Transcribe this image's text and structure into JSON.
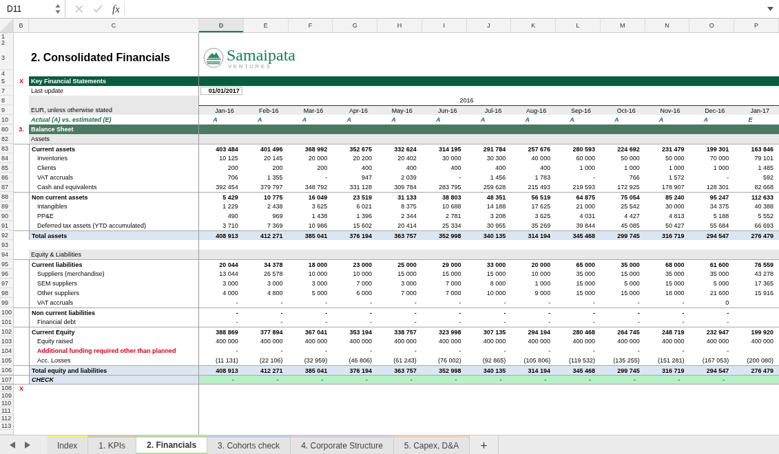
{
  "formula_bar": {
    "cell_ref": "D11",
    "fx": "fx"
  },
  "columns": [
    {
      "letter": "B",
      "selected": false
    },
    {
      "letter": "C",
      "selected": false
    },
    {
      "letter": "D",
      "selected": true
    },
    {
      "letter": "E",
      "selected": false
    },
    {
      "letter": "F",
      "selected": false
    },
    {
      "letter": "G",
      "selected": false
    },
    {
      "letter": "H",
      "selected": false
    },
    {
      "letter": "I",
      "selected": false
    },
    {
      "letter": "J",
      "selected": false
    },
    {
      "letter": "K",
      "selected": false
    },
    {
      "letter": "L",
      "selected": false
    },
    {
      "letter": "M",
      "selected": false
    },
    {
      "letter": "N",
      "selected": false
    },
    {
      "letter": "O",
      "selected": false
    },
    {
      "letter": "P",
      "selected": false
    }
  ],
  "rows": [
    {
      "num": "1",
      "kind": "blank"
    },
    {
      "num": "2",
      "kind": "blank"
    },
    {
      "num": "3",
      "kind": "title",
      "label": "2. Consolidated Financials",
      "logo": {
        "name": "Samaipata",
        "tagline": "VENTURES"
      }
    },
    {
      "num": "4",
      "kind": "blank"
    },
    {
      "num": "5",
      "kind": "banner",
      "marker": "X",
      "label": "Key Financial Statements"
    },
    {
      "num": "7",
      "kind": "meta",
      "label": "Last update",
      "value": "01/01/2017"
    },
    {
      "num": "8",
      "kind": "year",
      "value": "2016"
    },
    {
      "num": "9",
      "kind": "months",
      "label": "EUR, unless otherwise stated",
      "values": [
        "Jan-16",
        "Feb-16",
        "Mar-16",
        "Apr-16",
        "May-16",
        "Jun-16",
        "Jul-16",
        "Aug-16",
        "Sep-16",
        "Oct-16",
        "Nov-16",
        "Dec-16",
        "Jan-17"
      ]
    },
    {
      "num": "10",
      "kind": "flags",
      "label": "Actual (A) vs. estimated (E)",
      "values": [
        "A",
        "A",
        "A",
        "A",
        "A",
        "A",
        "A",
        "A",
        "A",
        "A",
        "A",
        "A",
        "E"
      ]
    },
    {
      "num": "80",
      "kind": "section",
      "marker": "3.",
      "label": "Balance Sheet"
    },
    {
      "num": "82",
      "kind": "band",
      "label": "Assets"
    },
    {
      "num": "83",
      "kind": "group",
      "label": "Current assets",
      "values": [
        "403 484",
        "401 496",
        "368 992",
        "352 675",
        "332 624",
        "314 195",
        "291 784",
        "257 676",
        "280 593",
        "224 692",
        "231 479",
        "199 301",
        "163 846"
      ]
    },
    {
      "num": "84",
      "kind": "item",
      "label": "Inventories",
      "values": [
        "10 125",
        "20 145",
        "20 000",
        "20 200",
        "20 402",
        "30 000",
        "30 300",
        "40 000",
        "60 000",
        "50 000",
        "50 000",
        "70 000",
        "79 101"
      ]
    },
    {
      "num": "85",
      "kind": "item",
      "label": "Clients",
      "values": [
        "200",
        "200",
        "200",
        "400",
        "400",
        "400",
        "400",
        "400",
        "1 000",
        "1 000",
        "1 000",
        "1 000",
        "1 485"
      ]
    },
    {
      "num": "86",
      "kind": "item",
      "label": "VAT accruals",
      "values": [
        "706",
        "1 355",
        "-",
        "947",
        "2 039",
        "-",
        "1 456",
        "1 783",
        "-",
        "766",
        "1 572",
        "-",
        "592"
      ]
    },
    {
      "num": "87",
      "kind": "item",
      "label": "Cash and equivalents",
      "values": [
        "392 454",
        "379 797",
        "348 792",
        "331 128",
        "309 784",
        "283 795",
        "259 628",
        "215 493",
        "219 593",
        "172 925",
        "178 907",
        "128 301",
        "82 668"
      ]
    },
    {
      "num": "88",
      "kind": "group",
      "label": "Non current assets",
      "values": [
        "5 429",
        "10 775",
        "16 049",
        "23 519",
        "31 133",
        "38 803",
        "48 351",
        "56 519",
        "64 875",
        "75 054",
        "85 240",
        "95 247",
        "112 633"
      ]
    },
    {
      "num": "89",
      "kind": "item",
      "label": "Intangibles",
      "values": [
        "1 229",
        "2 438",
        "3 625",
        "6 021",
        "8 375",
        "10 688",
        "14 188",
        "17 625",
        "21 000",
        "25 542",
        "30 000",
        "34 375",
        "40 388"
      ]
    },
    {
      "num": "90",
      "kind": "item",
      "label": "PP&E",
      "values": [
        "490",
        "969",
        "1 438",
        "1 396",
        "2 344",
        "2 781",
        "3 208",
        "3 625",
        "4 031",
        "4 427",
        "4 813",
        "5 188",
        "5 552"
      ]
    },
    {
      "num": "91",
      "kind": "item",
      "label": "Deferred tax assets (YTD accumulated)",
      "values": [
        "3 710",
        "7 369",
        "10 986",
        "15 602",
        "20 414",
        "25 334",
        "30 955",
        "35 269",
        "39 844",
        "45 085",
        "50 427",
        "55 684",
        "66 693"
      ]
    },
    {
      "num": "92",
      "kind": "total",
      "label": "Total assets",
      "values": [
        "408 913",
        "412 271",
        "385 041",
        "376 194",
        "363 757",
        "352 998",
        "340 135",
        "314 194",
        "345 468",
        "299 745",
        "316 719",
        "294 547",
        "276 479"
      ]
    },
    {
      "num": "93",
      "kind": "empty"
    },
    {
      "num": "94",
      "kind": "band",
      "label": "Equity & Liabilities"
    },
    {
      "num": "95",
      "kind": "group",
      "label": "Current liabilities",
      "values": [
        "20 044",
        "34 378",
        "18 000",
        "23 000",
        "25 000",
        "29 000",
        "33 000",
        "20 000",
        "65 000",
        "35 000",
        "68 000",
        "61 600",
        "76 559"
      ]
    },
    {
      "num": "96",
      "kind": "item",
      "label": "Suppliers (merchandise)",
      "values": [
        "13 044",
        "26 578",
        "10 000",
        "10 000",
        "15 000",
        "15 000",
        "15 000",
        "10 000",
        "35 000",
        "15 000",
        "35 000",
        "35 000",
        "43 278"
      ]
    },
    {
      "num": "97",
      "kind": "item",
      "label": "SEM suppliers",
      "values": [
        "3 000",
        "3 000",
        "3 000",
        "7 000",
        "3 000",
        "7 000",
        "8 000",
        "1 000",
        "15 000",
        "5 000",
        "15 000",
        "5 000",
        "17 365"
      ]
    },
    {
      "num": "98",
      "kind": "item",
      "label": "Other suppliers",
      "values": [
        "4 000",
        "4 800",
        "5 000",
        "6 000",
        "7 000",
        "7 000",
        "10 000",
        "9 000",
        "15 000",
        "15 000",
        "18 000",
        "21 600",
        "15 916"
      ]
    },
    {
      "num": "99",
      "kind": "item",
      "label": "VAT accruals",
      "values": [
        "-",
        "-",
        "-",
        "-",
        "-",
        "-",
        "-",
        "-",
        "-",
        "-",
        "-",
        "0"
      ]
    },
    {
      "num": "100",
      "kind": "group",
      "label": "Non current liabilities",
      "values": [
        "-",
        "-",
        "-",
        "-",
        "-",
        "-",
        "-",
        "-",
        "-",
        "-",
        "-",
        "-"
      ]
    },
    {
      "num": "101",
      "kind": "item",
      "label": "Financial debt",
      "values": [
        "-",
        "-",
        "-",
        "-",
        "-",
        "-",
        "-",
        "-",
        "-",
        "-",
        "-",
        "-"
      ]
    },
    {
      "num": "102",
      "kind": "group",
      "label": "Current Equity",
      "values": [
        "388 869",
        "377 894",
        "367 041",
        "353 194",
        "338 757",
        "323 998",
        "307 135",
        "294 194",
        "280 468",
        "264 745",
        "248 719",
        "232 947",
        "199 920"
      ]
    },
    {
      "num": "103",
      "kind": "item",
      "label": "Equity raised",
      "values": [
        "400 000",
        "400 000",
        "400 000",
        "400 000",
        "400 000",
        "400 000",
        "400 000",
        "400 000",
        "400 000",
        "400 000",
        "400 000",
        "400 000",
        "400 000"
      ]
    },
    {
      "num": "104",
      "kind": "alert",
      "label": "Additional funding required other than planned",
      "values": [
        "-",
        "-",
        "-",
        "-",
        "-",
        "-",
        "-",
        "-",
        "-",
        "-",
        "-",
        "-"
      ]
    },
    {
      "num": "105",
      "kind": "item",
      "label": "Acc. Losses",
      "values": [
        "(11 131)",
        "(22 106)",
        "(32 959)",
        "(46 806)",
        "(61 243)",
        "(76 002)",
        "(92 865)",
        "(105 806)",
        "(119 532)",
        "(135 255)",
        "(151 281)",
        "(167 053)",
        "(200 080)"
      ]
    },
    {
      "num": "106",
      "kind": "total",
      "label": "Total equity and liabilities",
      "values": [
        "408 913",
        "412 271",
        "385 041",
        "376 194",
        "363 757",
        "352 998",
        "340 135",
        "314 194",
        "345 468",
        "299 745",
        "316 719",
        "294 547",
        "276 479"
      ]
    },
    {
      "num": "107",
      "kind": "check",
      "label": "CHECK",
      "values": [
        "-",
        "-",
        "-",
        "-",
        "-",
        "-",
        "-",
        "-",
        "-",
        "-",
        "-",
        "-"
      ]
    },
    {
      "num": "108",
      "kind": "tail",
      "marker": "X"
    },
    {
      "num": "109",
      "kind": "tail"
    },
    {
      "num": "110",
      "kind": "tail"
    },
    {
      "num": "111",
      "kind": "tail"
    },
    {
      "num": "112",
      "kind": "tail"
    },
    {
      "num": "113",
      "kind": "tail"
    }
  ],
  "sheet_tabs": [
    {
      "label": "Index",
      "selected": false,
      "color": "#eef07a"
    },
    {
      "label": "1. KPIs",
      "selected": false,
      "color": "#cfc9ad"
    },
    {
      "label": "2. Financials",
      "selected": true,
      "color": "#b7dca0"
    },
    {
      "label": "3. Cohorts check",
      "selected": false,
      "color": "#bccfe6"
    },
    {
      "label": "4. Corporate Structure",
      "selected": false,
      "color": "#d9c9e4"
    },
    {
      "label": "5. Capex, D&A",
      "selected": false,
      "color": "#f5cfb4"
    }
  ],
  "add_sheet": "+"
}
